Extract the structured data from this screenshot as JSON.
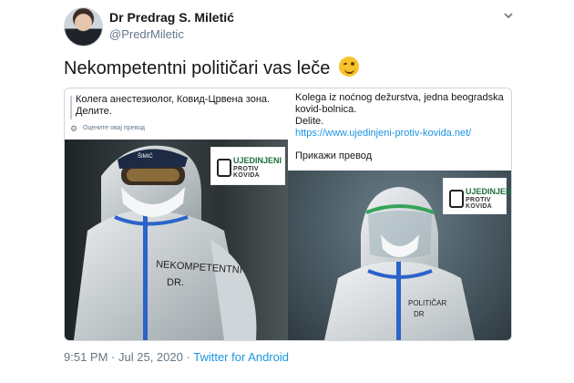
{
  "author": {
    "name": "Dr Predrag S. Miletić",
    "handle": "@PredrMiletic"
  },
  "tweet": {
    "text": "Nekompetentni političari vas leče",
    "emoji_icon": "winking-face-icon"
  },
  "embedded_left": {
    "caption_line1": "Колега анестезиолог, Ковид-Црвена зона.",
    "caption_line2": "Делите.",
    "translate": "Оцените овај превод",
    "logo_line1": "UJEDINJENI",
    "logo_line2": "PROTIV KOVIDA",
    "suit_text_line1": "NEKOMPETENTNI",
    "suit_text_line2": "DR.",
    "cap_text": "ŠIMIĆ"
  },
  "embedded_right": {
    "caption_line1": "Kolega iz noćnog dežurstva, jedna beogradska",
    "caption_line2": "kovid-bolnica.",
    "caption_line3": "Delite.",
    "link": "https://www.ujedinjeni-protiv-kovida.net/",
    "translate": "Прикажи превод",
    "logo_line1": "UJEDINJENI",
    "logo_line2": "PROTIV KOVIDA",
    "suit_text_line1": "POLITIČAR",
    "suit_text_line2": "DR"
  },
  "meta": {
    "time": "9:51 PM",
    "separator": "·",
    "date": "Jul 25, 2020",
    "source": "Twitter for Android"
  },
  "colors": {
    "link": "#1b95e0",
    "muted": "#657786",
    "text": "#14171a"
  }
}
